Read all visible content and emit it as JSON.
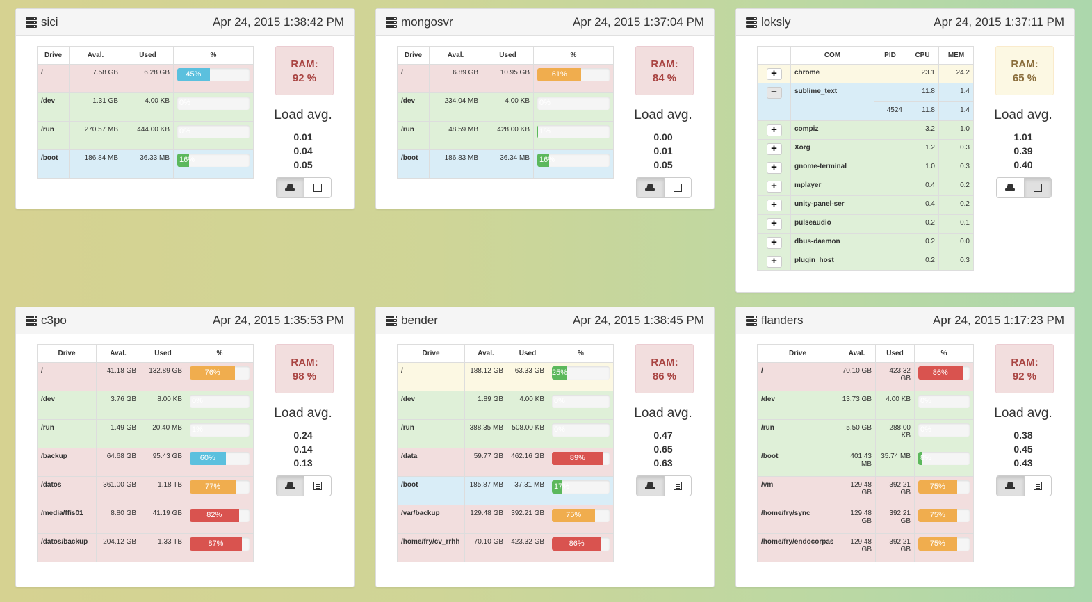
{
  "colors": {
    "red_row": "#f2dede",
    "green_row": "#dff0d8",
    "blue_row": "#d9edf7",
    "yellow_row": "#fcf8e3",
    "bar_blue": "#5bc0de",
    "bar_orange": "#f0ad4e",
    "bar_red": "#d9534f",
    "bar_green": "#5cb85c"
  },
  "servers": [
    {
      "name": "sici",
      "timestamp": "Apr 24, 2015 1:38:42 PM",
      "ram_label": "RAM:",
      "ram": "92 %",
      "load_title": "Load avg.",
      "load": [
        "0.01",
        "0.04",
        "0.05"
      ],
      "headers": [
        "Drive",
        "Aval.",
        "Used",
        "%"
      ],
      "drives": [
        {
          "drive": "/",
          "aval": "7.58 GB",
          "used": "6.28 GB",
          "pct": 45,
          "label": "45%",
          "row": "red",
          "bar": "blue"
        },
        {
          "drive": "/dev",
          "aval": "1.31 GB",
          "used": "4.00 KB",
          "pct": 0,
          "label": "0%",
          "row": "green",
          "bar": "green"
        },
        {
          "drive": "/run",
          "aval": "270.57 MB",
          "used": "444.00 KB",
          "pct": 0,
          "label": "0%",
          "row": "green",
          "bar": "green"
        },
        {
          "drive": "/boot",
          "aval": "186.84 MB",
          "used": "36.33 MB",
          "pct": 16,
          "label": "16%",
          "row": "blue",
          "bar": "green"
        }
      ]
    },
    {
      "name": "mongosvr",
      "timestamp": "Apr 24, 2015 1:37:04 PM",
      "ram_label": "RAM:",
      "ram": "84 %",
      "load_title": "Load avg.",
      "load": [
        "0.00",
        "0.01",
        "0.05"
      ],
      "headers": [
        "Drive",
        "Aval.",
        "Used",
        "%"
      ],
      "drives": [
        {
          "drive": "/",
          "aval": "6.89 GB",
          "used": "10.95 GB",
          "pct": 61,
          "label": "61%",
          "row": "red",
          "bar": "orange"
        },
        {
          "drive": "/dev",
          "aval": "234.04 MB",
          "used": "4.00 KB",
          "pct": 0,
          "label": "0%",
          "row": "green",
          "bar": "green"
        },
        {
          "drive": "/run",
          "aval": "48.59 MB",
          "used": "428.00 KB",
          "pct": 1,
          "label": "1%",
          "row": "green",
          "bar": "green"
        },
        {
          "drive": "/boot",
          "aval": "186.83 MB",
          "used": "36.34 MB",
          "pct": 16,
          "label": "16%",
          "row": "blue",
          "bar": "green"
        }
      ]
    },
    {
      "name": "loksly",
      "timestamp": "Apr 24, 2015 1:37:11 PM",
      "ram_label": "RAM:",
      "ram": "65 %",
      "load_title": "Load avg.",
      "load": [
        "1.01",
        "0.39",
        "0.40"
      ],
      "proc_headers": [
        "COM",
        "PID",
        "CPU",
        "MEM"
      ],
      "processes": [
        {
          "btn": "+",
          "com": "chrome",
          "pid": "",
          "cpu": "23.1",
          "mem": "24.2",
          "row": "yellow"
        },
        {
          "btn": "−",
          "com": "sublime_text",
          "pid": "",
          "cpu": "11.8",
          "mem": "1.4",
          "row": "blue",
          "child": {
            "pid": "4524",
            "cpu": "11.8",
            "mem": "1.4"
          }
        },
        {
          "btn": "+",
          "com": "compiz",
          "pid": "",
          "cpu": "3.2",
          "mem": "1.0",
          "row": "green"
        },
        {
          "btn": "+",
          "com": "Xorg",
          "pid": "",
          "cpu": "1.2",
          "mem": "0.3",
          "row": "green"
        },
        {
          "btn": "+",
          "com": "gnome-terminal",
          "pid": "",
          "cpu": "1.0",
          "mem": "0.3",
          "row": "green"
        },
        {
          "btn": "+",
          "com": "mplayer",
          "pid": "",
          "cpu": "0.4",
          "mem": "0.2",
          "row": "green"
        },
        {
          "btn": "+",
          "com": "unity-panel-ser",
          "pid": "",
          "cpu": "0.4",
          "mem": "0.2",
          "row": "green"
        },
        {
          "btn": "+",
          "com": "pulseaudio",
          "pid": "",
          "cpu": "0.2",
          "mem": "0.1",
          "row": "green"
        },
        {
          "btn": "+",
          "com": "dbus-daemon",
          "pid": "",
          "cpu": "0.2",
          "mem": "0.0",
          "row": "green"
        },
        {
          "btn": "+",
          "com": "plugin_host",
          "pid": "",
          "cpu": "0.2",
          "mem": "0.3",
          "row": "green"
        }
      ]
    },
    {
      "name": "c3po",
      "timestamp": "Apr 24, 2015 1:35:53 PM",
      "ram_label": "RAM:",
      "ram": "98 %",
      "load_title": "Load avg.",
      "load": [
        "0.24",
        "0.14",
        "0.13"
      ],
      "headers": [
        "Drive",
        "Aval.",
        "Used",
        "%"
      ],
      "drives": [
        {
          "drive": "/",
          "aval": "41.18 GB",
          "used": "132.89 GB",
          "pct": 76,
          "label": "76%",
          "row": "red",
          "bar": "orange"
        },
        {
          "drive": "/dev",
          "aval": "3.76 GB",
          "used": "8.00 KB",
          "pct": 0,
          "label": "0%",
          "row": "green",
          "bar": "green"
        },
        {
          "drive": "/run",
          "aval": "1.49 GB",
          "used": "20.40 MB",
          "pct": 1,
          "label": "1%",
          "row": "green",
          "bar": "green"
        },
        {
          "drive": "/backup",
          "aval": "64.68 GB",
          "used": "95.43 GB",
          "pct": 60,
          "label": "60%",
          "row": "red",
          "bar": "blue"
        },
        {
          "drive": "/datos",
          "aval": "361.00 GB",
          "used": "1.18 TB",
          "pct": 77,
          "label": "77%",
          "row": "red",
          "bar": "orange"
        },
        {
          "drive": "/media/ffis01",
          "aval": "8.80 GB",
          "used": "41.19 GB",
          "pct": 82,
          "label": "82%",
          "row": "red",
          "bar": "red"
        },
        {
          "drive": "/datos/backup",
          "aval": "204.12 GB",
          "used": "1.33 TB",
          "pct": 87,
          "label": "87%",
          "row": "red",
          "bar": "red"
        }
      ]
    },
    {
      "name": "bender",
      "timestamp": "Apr 24, 2015 1:38:45 PM",
      "ram_label": "RAM:",
      "ram": "86 %",
      "load_title": "Load avg.",
      "load": [
        "0.47",
        "0.65",
        "0.63"
      ],
      "headers": [
        "Drive",
        "Aval.",
        "Used",
        "%"
      ],
      "drives": [
        {
          "drive": "/",
          "aval": "188.12 GB",
          "used": "63.33 GB",
          "pct": 25,
          "label": "25%",
          "row": "yellow",
          "bar": "green"
        },
        {
          "drive": "/dev",
          "aval": "1.89 GB",
          "used": "4.00 KB",
          "pct": 0,
          "label": "0%",
          "row": "green",
          "bar": "green"
        },
        {
          "drive": "/run",
          "aval": "388.35 MB",
          "used": "508.00 KB",
          "pct": 0,
          "label": "0%",
          "row": "green",
          "bar": "green"
        },
        {
          "drive": "/data",
          "aval": "59.77 GB",
          "used": "462.16 GB",
          "pct": 89,
          "label": "89%",
          "row": "red",
          "bar": "red"
        },
        {
          "drive": "/boot",
          "aval": "185.87 MB",
          "used": "37.31 MB",
          "pct": 17,
          "label": "17%",
          "row": "blue",
          "bar": "green"
        },
        {
          "drive": "/var/backup",
          "aval": "129.48 GB",
          "used": "392.21 GB",
          "pct": 75,
          "label": "75%",
          "row": "red",
          "bar": "orange"
        },
        {
          "drive": "/home/fry/cv_rrhh",
          "aval": "70.10 GB",
          "used": "423.32 GB",
          "pct": 86,
          "label": "86%",
          "row": "red",
          "bar": "red"
        }
      ]
    },
    {
      "name": "flanders",
      "timestamp": "Apr 24, 2015 1:17:23 PM",
      "ram_label": "RAM:",
      "ram": "92 %",
      "load_title": "Load avg.",
      "load": [
        "0.38",
        "0.45",
        "0.43"
      ],
      "headers": [
        "Drive",
        "Aval.",
        "Used",
        "%"
      ],
      "drives": [
        {
          "drive": "/",
          "aval": "70.10 GB",
          "used": "423.32 GB",
          "pct": 86,
          "label": "86%",
          "row": "red",
          "bar": "red"
        },
        {
          "drive": "/dev",
          "aval": "13.73 GB",
          "used": "4.00 KB",
          "pct": 0,
          "label": "0%",
          "row": "green",
          "bar": "green"
        },
        {
          "drive": "/run",
          "aval": "5.50 GB",
          "used": "288.00 KB",
          "pct": 0,
          "label": "0%",
          "row": "green",
          "bar": "green"
        },
        {
          "drive": "/boot",
          "aval": "401.43 MB",
          "used": "35.74 MB",
          "pct": 8,
          "label": "8%",
          "row": "green",
          "bar": "green"
        },
        {
          "drive": "/vm",
          "aval": "129.48 GB",
          "used": "392.21 GB",
          "pct": 75,
          "label": "75%",
          "row": "red",
          "bar": "orange"
        },
        {
          "drive": "/home/fry/sync",
          "aval": "129.48 GB",
          "used": "392.21 GB",
          "pct": 75,
          "label": "75%",
          "row": "red",
          "bar": "orange"
        },
        {
          "drive": "/home/fry/endocorpas",
          "aval": "129.48 GB",
          "used": "392.21 GB",
          "pct": 75,
          "label": "75%",
          "row": "red",
          "bar": "orange"
        }
      ]
    }
  ]
}
